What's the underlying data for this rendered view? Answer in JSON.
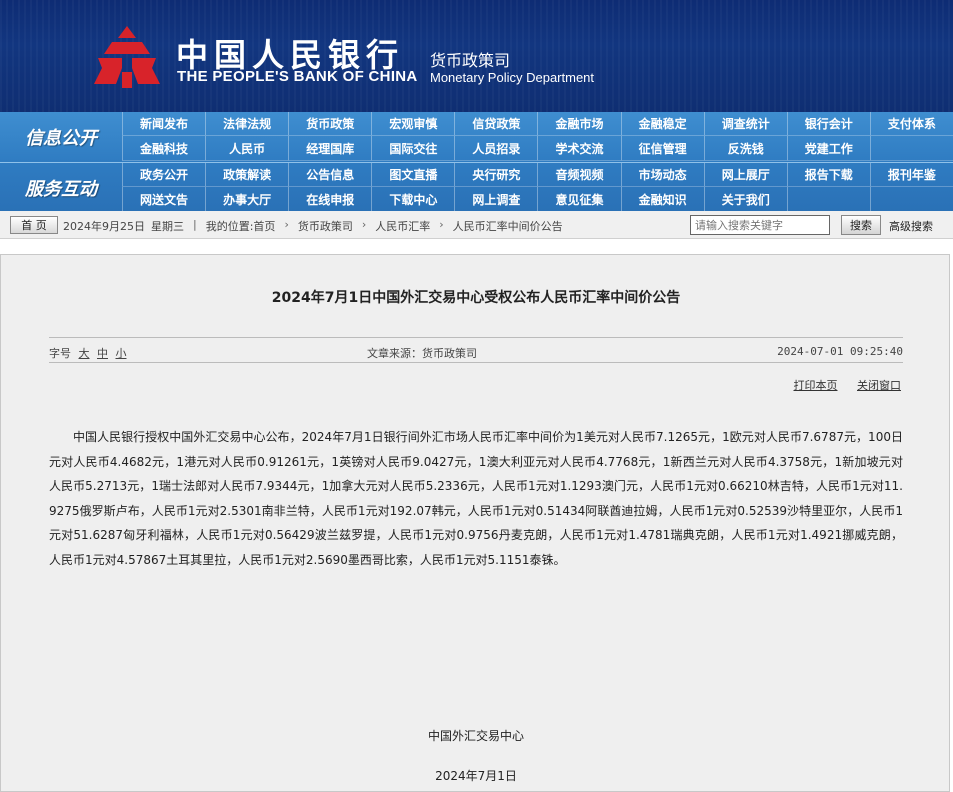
{
  "header": {
    "bank_name_cn": "中国人民银行",
    "bank_name_en": "THE PEOPLE'S BANK OF CHINA",
    "dept_cn": "货币政策司",
    "dept_en": "Monetary Policy Department",
    "logo_color": "#d8232a"
  },
  "nav": {
    "info_title": "信息公开",
    "info_items": [
      "新闻发布",
      "法律法规",
      "货币政策",
      "宏观审慎",
      "信贷政策",
      "金融市场",
      "金融稳定",
      "调查统计",
      "银行会计",
      "支付体系",
      "金融科技",
      "人民币",
      "经理国库",
      "国际交往",
      "人员招录",
      "学术交流",
      "征信管理",
      "反洗钱",
      "党建工作",
      ""
    ],
    "service_title": "服务互动",
    "service_items": [
      "政务公开",
      "政策解读",
      "公告信息",
      "图文直播",
      "央行研究",
      "音频视频",
      "市场动态",
      "网上展厅",
      "报告下载",
      "报刊年鉴",
      "网送文告",
      "办事大厅",
      "在线申报",
      "下载中心",
      "网上调查",
      "意见征集",
      "金融知识",
      "关于我们",
      "",
      ""
    ]
  },
  "crumb": {
    "home": "首 页",
    "date": "2024年9月25日",
    "weekday": "星期三",
    "location_label": "我的位置:首页",
    "level1": "货币政策司",
    "level2": "人民币汇率",
    "level3": "人民币汇率中间价公告",
    "search_placeholder": "请输入搜索关键字",
    "search_btn": "搜索",
    "advanced": "高级搜索"
  },
  "article": {
    "title": "2024年7月1日中国外汇交易中心受权公布人民币汇率中间价公告",
    "font_label": "字号",
    "font_large": "大",
    "font_mid": "中",
    "font_small": "小",
    "source": "文章来源：货币政策司",
    "time": "2024-07-01 09:25:40",
    "print": "打印本页",
    "close": "关闭窗口",
    "body": "中国人民银行授权中国外汇交易中心公布，2024年7月1日银行间外汇市场人民币汇率中间价为1美元对人民币7.1265元，1欧元对人民币7.6787元，100日元对人民币4.4682元，1港元对人民币0.91261元，1英镑对人民币9.0427元，1澳大利亚元对人民币4.7768元，1新西兰元对人民币4.3758元，1新加坡元对人民币5.2713元，1瑞士法郎对人民币7.9344元，1加拿大元对人民币5.2336元，人民币1元对1.1293澳门元，人民币1元对0.66210林吉特，人民币1元对11.9275俄罗斯卢布，人民币1元对2.5301南非兰特，人民币1元对192.07韩元，人民币1元对0.51434阿联酋迪拉姆，人民币1元对0.52539沙特里亚尔，人民币1元对51.6287匈牙利福林，人民币1元对0.56429波兰兹罗提，人民币1元对0.9756丹麦克朗，人民币1元对1.4781瑞典克朗，人民币1元对1.4921挪威克朗，人民币1元对4.57867土耳其里拉，人民币1元对2.5690墨西哥比索，人民币1元对5.1151泰铢。",
    "sign_org": "中国外汇交易中心",
    "sign_date": "2024年7月1日"
  }
}
